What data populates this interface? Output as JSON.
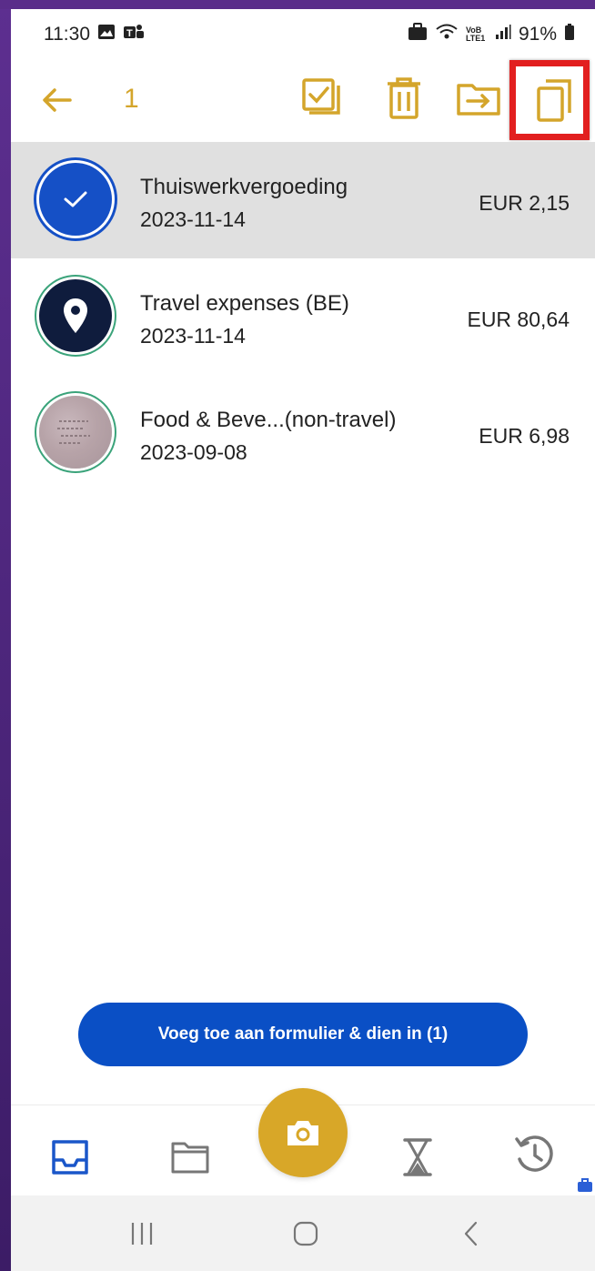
{
  "status_bar": {
    "time": "11:30",
    "battery": "91%",
    "network": "VoB LTE1"
  },
  "toolbar": {
    "selected_count": "1",
    "icons": [
      "back-arrow-icon",
      "select-all-icon",
      "trash-icon",
      "move-icon",
      "copy-icon"
    ],
    "accent_color": "#d4a52b",
    "highlight_color": "#e21f1f"
  },
  "expenses": [
    {
      "title": "Thuiswerkvergoeding",
      "date": "2023-11-14",
      "amount": "EUR 2,15",
      "icon": "check-icon",
      "selected": true
    },
    {
      "title": "Travel expenses (BE)",
      "date": "2023-11-14",
      "amount": "EUR 80,64",
      "icon": "location-pin-icon",
      "selected": false
    },
    {
      "title": "Food & Beve...(non-travel)",
      "date": "2023-09-08",
      "amount": "EUR 6,98",
      "icon": "receipt-thumbnail",
      "selected": false
    }
  ],
  "submit_button": {
    "label": "Voeg toe aan formulier & dien in (1)",
    "color": "#0a4fc5"
  },
  "bottom_nav": {
    "items": [
      "inbox-icon",
      "folder-icon",
      "camera-icon",
      "hourglass-icon",
      "history-icon"
    ],
    "active": "inbox-icon",
    "fab_color": "#d8a728"
  }
}
